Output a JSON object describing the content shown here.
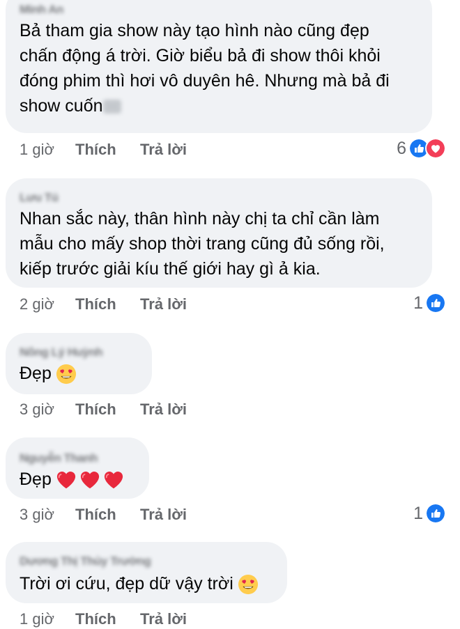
{
  "comments": [
    {
      "author": "Minh An",
      "text": "Bả tham gia show này tạo hình nào cũng đẹp\nchấn động á trời. Giờ biểu bả đi show thôi khỏi\nđóng phim thì hơi vô duyên hê. Nhưng mà bả đi\nshow cuốn",
      "time": "1 giờ",
      "like_label": "Thích",
      "reply_label": "Trả lời",
      "reaction_count": "6",
      "reactions": [
        "like-icon",
        "love-icon"
      ]
    },
    {
      "author": "Lưu Tú",
      "text": "Nhan sắc này, thân hình này chị ta chỉ cần làm\nmẫu cho mấy shop thời trang cũng đủ sống rồi,\nkiếp trước giải kíu thế giới hay gì ả kia.",
      "time": "2 giờ",
      "like_label": "Thích",
      "reply_label": "Trả lời",
      "reaction_count": "1",
      "reactions": [
        "like-icon"
      ]
    },
    {
      "author": "Nông Lý Huỳnh",
      "text": "Đẹp",
      "emojis": [
        "heart-eyes-emoji"
      ],
      "time": "3 giờ",
      "like_label": "Thích",
      "reply_label": "Trả lời",
      "reaction_count": "",
      "reactions": []
    },
    {
      "author": "Nguyễn Thanh",
      "text": "Đẹp",
      "emojis": [
        "red-heart-emoji",
        "red-heart-emoji",
        "red-heart-emoji"
      ],
      "time": "3 giờ",
      "like_label": "Thích",
      "reply_label": "Trả lời",
      "reaction_count": "1",
      "reactions": [
        "like-icon"
      ]
    },
    {
      "author": "Dương Thị Thủy Trường",
      "text": "Trời ơi cứu, đẹp dữ vậy trời",
      "emojis": [
        "heart-eyes-emoji"
      ],
      "time": "1 giờ",
      "like_label": "Thích",
      "reply_label": "Trả lời",
      "reaction_count": "",
      "reactions": []
    }
  ],
  "colors": {
    "bubble": "#f0f2f5",
    "meta_text": "#65676b",
    "like_blue": "#1877f2",
    "love_red": "#f33e58"
  }
}
